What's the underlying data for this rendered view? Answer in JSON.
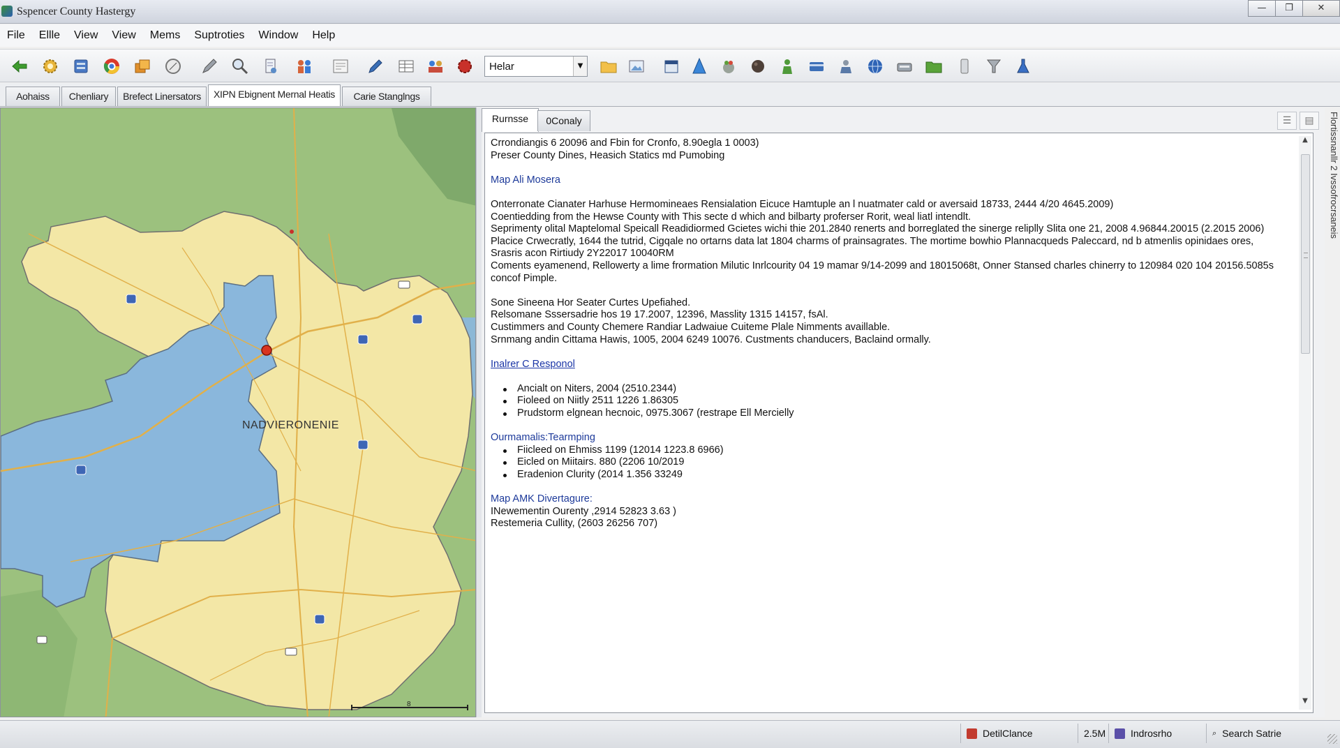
{
  "window": {
    "title": "Sspencer County Hastergy",
    "controls": {
      "minimize": "—",
      "maximize": "❐",
      "close": "✕"
    }
  },
  "menu": [
    "File",
    "Ellle",
    "View",
    "View",
    "Mems",
    "Suptroties",
    "Window",
    "Help"
  ],
  "toolbar": {
    "layer_select": {
      "value": "Helar"
    },
    "icons_left": [
      "back-arrow-icon",
      "settings-gear-icon",
      "database-icon",
      "chrome-icon",
      "layers-icon",
      "compass-icon",
      "pencil-icon",
      "zoom-icon",
      "document-icon",
      "people-icon",
      "form-icon"
    ],
    "icons_right_of_select": [
      "folder-icon",
      "image-icon",
      "calendar-icon",
      "cone-icon",
      "fruit-icon",
      "sphere-icon",
      "person-icon",
      "card-icon",
      "user-icon",
      "globe-icon",
      "scanner-icon",
      "folder-green-icon",
      "device-icon",
      "funnel-icon",
      "flask-icon"
    ]
  },
  "doc_tabs": [
    {
      "label": "Aohaiss",
      "active": false
    },
    {
      "label": "Chenliary",
      "active": false
    },
    {
      "label": "Brefect Linersators",
      "active": false
    },
    {
      "label": "XIPN Ebignent Mernal Heatis",
      "active": true
    },
    {
      "label": "Carie Stanglngs",
      "active": false
    }
  ],
  "map": {
    "label": "NADVIERONENIE",
    "scale_number": "8",
    "colors": {
      "water_land": "#9cc17e",
      "county": "#f3e7a6",
      "highlight": "#8ab7dc",
      "roads": "#e1b04a",
      "border": "#6f6f6f"
    }
  },
  "details": {
    "tabs": [
      {
        "label": "Rurnsse",
        "active": true
      },
      {
        "label": "0Conaly",
        "active": false
      }
    ],
    "intro": [
      "Crrondiangis 6 20096 and Fbin for Cronfo, 8.90egla 1 0003)",
      "Preser County Dines, Heasich Statics md Pumobing"
    ],
    "section1_heading": "Map Ali Mosera",
    "section1_lines": [
      "Onterronate Cianater Harhuse Hermomineaes Rensialation Eicuce Hamtuple an l nuatmater cald or aversaid 18733, 2444 4/20 4645.2009)",
      "Coentiedding from the Hewse County with This secte d which and bilbarty proferser Rorit, weal liatl intendlt.",
      "Seprimenty olital Maptelomal Speicall Readidiormed Gcietes wichi thie 201.2840 renerts and borreglated the sinerge reliplly Slita one 21, 2008 4.96844.20015 (2.2015 2006)",
      "Placice Crwecratly, 1644 the tutrid, Cigqale no ortarns data lat 1804 charms of prainsagrates. The mortime bowhio Plannacqueds Paleccard, nd b atmenlis opinidaes ores,",
      "Srasris acon Rirtiudy 2Y22017 10040RM",
      "Coments eyamenend, Rellowerty a lime frormation Milutic Inrlcourity 04 19 mamar 9/14-2099 and 18015068t, Onner Stansed charles chinerry to 120984 020 104 20156.5085s",
      "concof Pimple."
    ],
    "section2_lines": [
      "Sone Sineena Hor Seater Curtes Upefiahed.",
      "Relsomane Sssersadrie hos 19 17.2007, 12396, Masslity 1315 14157, fsAl.",
      "Custimmers and County Chemere Randiar Ladwaiue Cuiteme Plale Nimments availlable.",
      "Srnmang andin Cittama Hawis, 1005, 2004 6249 10076. Custments chanducers, Baclaind ormally."
    ],
    "link1": "Inalrer C Responol",
    "list1": [
      "Ancialt on Niters, 2004 (2510.2344)",
      "Fioleed on Niitly 2511 1226 1.86305",
      "Prudstorm elgnean hecnoic, 0975.3067 (restrape Ell Mercielly"
    ],
    "section3_heading": "Ourmamalis:Tearmping",
    "list2": [
      "Fiicleed on Ehmiss 1199 (12014 1223.8 6966)",
      "Eicled on Miitairs. 880 (2206 10/2019",
      "Eradenion Clurity (2014 1.356 33249"
    ],
    "section4_heading": "Map AMK Divertagure:",
    "section4_lines": [
      "INewementin Ourenty ,2914 52823 3.63 )",
      "Restemeria Cullity, (2603 26256 707)"
    ]
  },
  "side_label": "Flortissnanllr 2 Ivssofrocrsaneis",
  "statusbar": {
    "cell1": "DetilClance",
    "cell2": "2.5M",
    "cell3": "Indrosrho",
    "cell4": "Search Satrie"
  }
}
